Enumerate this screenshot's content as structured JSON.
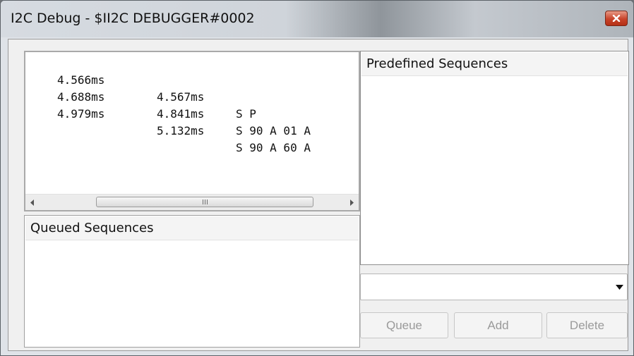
{
  "window": {
    "title": "I2C Debug - $II2C DEBUGGER#0002",
    "close_icon": "close-icon"
  },
  "log": {
    "rows": [
      {
        "start": "4.566ms",
        "end": "4.567ms",
        "data": "S P"
      },
      {
        "start": "4.688ms",
        "end": "4.841ms",
        "data": "S 90 A 01 A"
      },
      {
        "start": "4.979ms",
        "end": "5.132ms",
        "data": "S 90 A 60 A"
      }
    ],
    "grip_icon": "III"
  },
  "queued": {
    "header": "Queued Sequences"
  },
  "predefined": {
    "header": "Predefined Sequences"
  },
  "combo": {
    "value": ""
  },
  "buttons": {
    "queue": "Queue",
    "add": "Add",
    "delete": "Delete"
  }
}
